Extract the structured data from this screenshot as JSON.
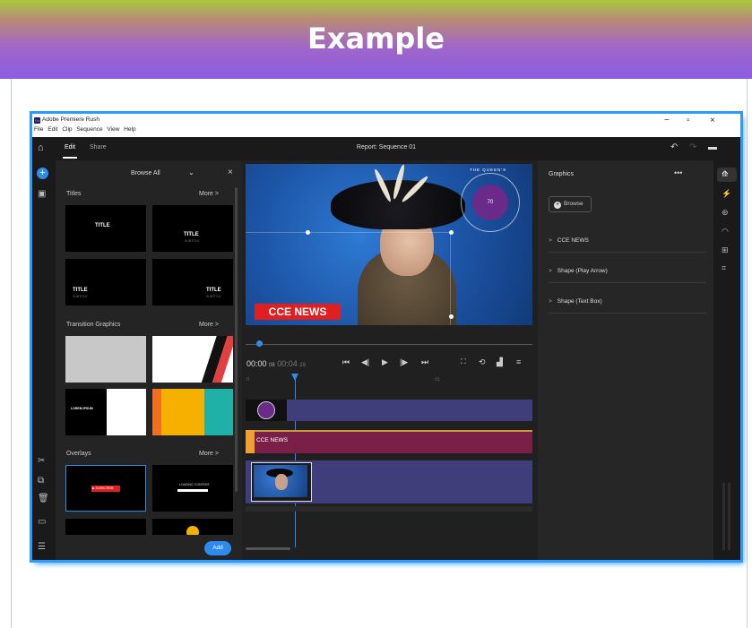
{
  "banner": {
    "title": "Example"
  },
  "titlebar": {
    "app_name": "Adobe Premiere Rush",
    "app_icon": "Ru",
    "menu": [
      "File",
      "Edit",
      "Clip",
      "Sequence",
      "View",
      "Help"
    ],
    "minimize": "−",
    "restore": "▫",
    "close": "×"
  },
  "topbar": {
    "tabs": {
      "edit": "Edit",
      "share": "Share"
    },
    "sequence_title": "Report: Sequence 01"
  },
  "browser": {
    "header": "Browse All",
    "sections": {
      "titles": {
        "label": "Titles",
        "more": "More >",
        "thumbs": [
          {
            "title": "TITLE",
            "subtitle": ""
          },
          {
            "title": "TITLE",
            "subtitle": "SUBTITLE"
          },
          {
            "title": "TITLE",
            "subtitle": "SUBTITLE"
          },
          {
            "title": "TITLE",
            "subtitle": "SUBTITLE"
          }
        ]
      },
      "transitions": {
        "label": "Transition Graphics",
        "more": "More >",
        "lorem": "LOREM IPSUM"
      },
      "overlays": {
        "label": "Overlays",
        "more": "More >",
        "subscribe": "▶ SUBSCRIBE",
        "loading": "LOADING CONTENT"
      }
    },
    "add_button": "Add"
  },
  "monitor": {
    "badge": "CCE NEWS",
    "jubilee_text": "THE QUEEN'S",
    "jubilee_num": "70",
    "timecode_current": "00:00",
    "timecode_current_frames": "08",
    "timecode_duration": "00:04",
    "timecode_duration_frames": "29",
    "ruler_start": ":0",
    "ruler_mark": ":01"
  },
  "timeline": {
    "track2_label": "CCE NEWS"
  },
  "properties": {
    "title": "Graphics",
    "browse": "Browse",
    "rows": [
      "CCE NEWS",
      "Shape (Play Arrow)",
      "Shape (Text Box)"
    ]
  },
  "colors": {
    "accent": "#2d8ceb",
    "badge_red": "#e02020",
    "track_purple": "#3f3e7a",
    "track_magenta": "#7a1f48"
  }
}
